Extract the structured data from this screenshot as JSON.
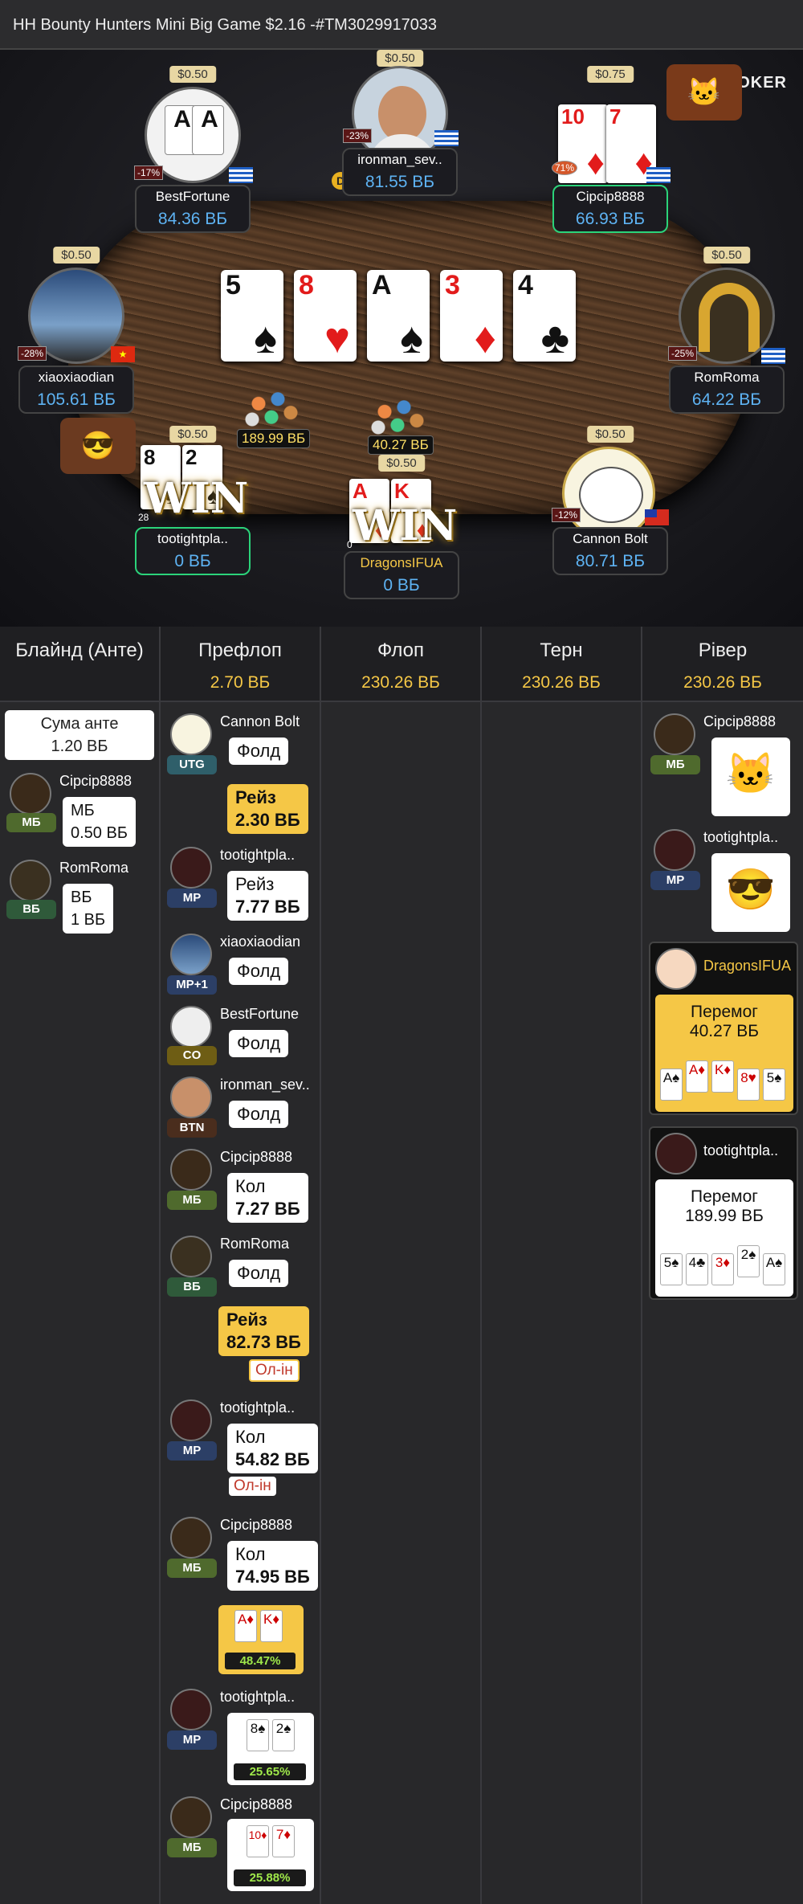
{
  "title": "HH Bounty Hunters Mini Big Game $2.16 -#TM3029917033",
  "logo": "POKER",
  "seats": [
    {
      "name": "BestFortune",
      "stack": "84.36 ВБ",
      "bet": "$0.50",
      "pct": "-17%"
    },
    {
      "name": "ironman_sev..",
      "stack": "81.55 ВБ",
      "bet": "$0.50",
      "pct": "-23%",
      "dealer": "D"
    },
    {
      "name": "Cipcip8888",
      "stack": "66.93 ВБ",
      "bet": "$0.75",
      "pct": "71%"
    },
    {
      "name": "xiaoxiaodian",
      "stack": "105.61 ВБ",
      "bet": "$0.50",
      "pct": "-28%"
    },
    {
      "name": "RomRoma",
      "stack": "64.22 ВБ",
      "bet": "$0.50",
      "pct": "-25%"
    },
    {
      "name": "tootightpla..",
      "stack": "0 ВБ",
      "bet": "$0.50",
      "pct": "28",
      "win": "WIN"
    },
    {
      "name": "DragonsIFUA",
      "stack": "0 ВБ",
      "bet": "$0.50",
      "pct": "0",
      "win": "WIN"
    },
    {
      "name": "Cannon Bolt",
      "stack": "80.71 ВБ",
      "bet": "$0.50",
      "pct": "-12%"
    }
  ],
  "board": [
    {
      "r": "5",
      "s": "♠",
      "c": "blk"
    },
    {
      "r": "8",
      "s": "♥",
      "c": "red"
    },
    {
      "r": "A",
      "s": "♠",
      "c": "blk"
    },
    {
      "r": "3",
      "s": "♦",
      "c": "red"
    },
    {
      "r": "4",
      "s": "♣",
      "c": "blk"
    }
  ],
  "holes": {
    "p3": [
      {
        "r": "10",
        "s": "♦",
        "c": "red"
      },
      {
        "r": "7",
        "s": "♦",
        "c": "red"
      }
    ],
    "p6": [
      {
        "r": "8",
        "s": "♠",
        "c": "blk"
      },
      {
        "r": "2",
        "s": "♠",
        "c": "blk"
      }
    ],
    "p7": [
      {
        "r": "A",
        "s": "♦",
        "c": "red"
      },
      {
        "r": "K",
        "s": "♦",
        "c": "red"
      }
    ]
  },
  "pots": [
    "189.99 ВБ",
    "40.27 ВБ"
  ],
  "streets": [
    {
      "label": "Блайнд (Анте)",
      "value": ""
    },
    {
      "label": "Префлоп",
      "value": "2.70 ВБ"
    },
    {
      "label": "Флоп",
      "value": "230.26 ВБ"
    },
    {
      "label": "Терн",
      "value": "230.26 ВБ"
    },
    {
      "label": "Рівер",
      "value": "230.26 ВБ"
    }
  ],
  "blinds": {
    "ante_l1": "Сума анте",
    "ante_l2": "1.20 ВБ",
    "p1": {
      "name": "Cipcip8888",
      "pos": "МБ",
      "a1": "МБ",
      "a2": "0.50 ВБ"
    },
    "p2": {
      "name": "RomRoma",
      "pos": "ВБ",
      "a1": "ВБ",
      "a2": "1 ВБ"
    }
  },
  "preflop": [
    {
      "name": "Cannon Bolt",
      "pos": "UTG",
      "a1": "Фолд"
    },
    {
      "a1": "Рейз",
      "a2": "2.30 ВБ"
    },
    {
      "name": "tootightpla..",
      "pos": "MP",
      "a1": "Рейз",
      "a2": "7.77 ВБ"
    },
    {
      "name": "xiaoxiaodian",
      "pos": "MP+1",
      "a1": "Фолд"
    },
    {
      "name": "BestFortune",
      "pos": "CO",
      "a1": "Фолд"
    },
    {
      "name": "ironman_sev..",
      "pos": "BTN",
      "a1": "Фолд"
    },
    {
      "name": "Cipcip8888",
      "pos": "МБ",
      "a1": "Кол",
      "a2": "7.27 ВБ"
    },
    {
      "name": "RomRoma",
      "pos": "ВБ",
      "a1": "Фолд"
    },
    {
      "a1": "Рейз",
      "a2": "82.73 ВБ",
      "allin": "Ол-ін"
    },
    {
      "name": "tootightpla..",
      "pos": "MP",
      "a1": "Кол",
      "a2": "54.82 ВБ",
      "allin": "Ол-ін"
    },
    {
      "name": "Cipcip8888",
      "pos": "МБ",
      "a1": "Кол",
      "a2": "74.95 ВБ"
    }
  ],
  "equity": [
    {
      "cards": [
        "A♦",
        "K♦"
      ],
      "eq": "48.47%"
    },
    {
      "name": "tootightpla..",
      "pos": "MP",
      "cards": [
        "8♠",
        "2♠"
      ],
      "eq": "25.65%"
    },
    {
      "name": "Cipcip8888",
      "pos": "МБ",
      "cards": [
        "10♦",
        "7♦"
      ],
      "eq": "25.88%"
    }
  ],
  "river": {
    "p1": {
      "name": "Cipcip8888",
      "pos": "МБ"
    },
    "p2": {
      "name": "tootightpla..",
      "pos": "MP"
    },
    "w1": {
      "name": "DragonsIFUA",
      "label": "Перемог",
      "amount": "40.27 ВБ",
      "cards": [
        "A♠",
        "A♦",
        "K♦",
        "8♥",
        "5♠"
      ]
    },
    "w2": {
      "name": "tootightpla..",
      "label": "Перемог",
      "amount": "189.99 ВБ",
      "cards": [
        "5♠",
        "4♣",
        "3♦",
        "2♠",
        "A♠"
      ]
    }
  }
}
